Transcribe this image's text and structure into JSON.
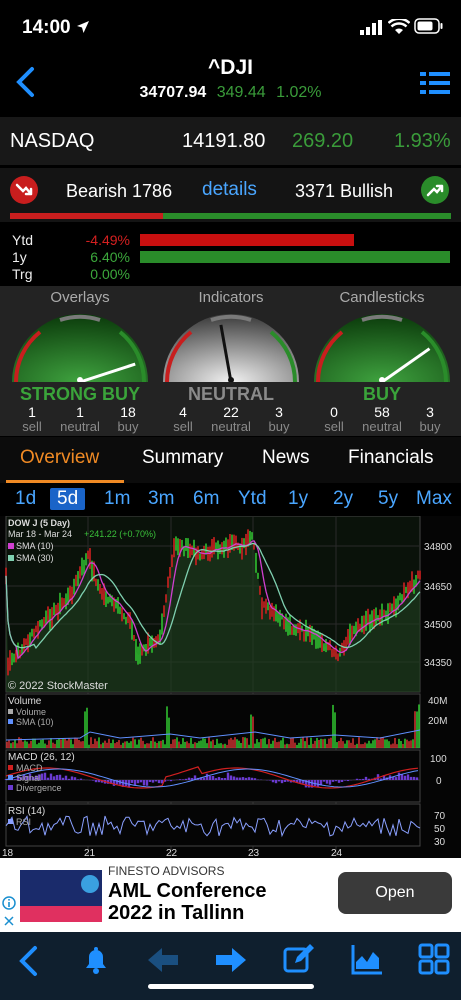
{
  "status": {
    "time": "14:00"
  },
  "header": {
    "ticker": "^DJI",
    "price": "34707.94",
    "change": "349.44",
    "change_pct": "1.02%"
  },
  "index_row": {
    "name": "NASDAQ",
    "value": "14191.80",
    "change": "269.20",
    "change_pct": "1.93%"
  },
  "sentiment": {
    "bearish": "Bearish 1786",
    "details": "details",
    "bullish": "3371 Bullish",
    "bearish_fraction": 0.346
  },
  "performance": [
    {
      "label": "Ytd",
      "value": "-4.49%",
      "color": "#d42020",
      "bar_fraction": 0.69,
      "bar_color": "#c80f0f"
    },
    {
      "label": "1y",
      "value": "6.40%",
      "color": "#3ca83c",
      "bar_fraction": 1.0,
      "bar_color": "#2a8c2a"
    },
    {
      "label": "Trg",
      "value": "0.00%",
      "color": "#3ca83c",
      "bar_fraction": 0,
      "bar_color": "#2a8c2a"
    }
  ],
  "gauges": [
    {
      "title": "Overlays",
      "signal": "STRONG BUY",
      "signal_color": "#3aa43a",
      "counts": [
        "1",
        "1",
        "18"
      ],
      "subs": [
        "sell",
        "neutral",
        "buy"
      ]
    },
    {
      "title": "Indicators",
      "signal": "NEUTRAL",
      "signal_color": "#8a8a8a",
      "counts": [
        "4",
        "22",
        "3"
      ],
      "subs": [
        "sell",
        "neutral",
        "buy"
      ]
    },
    {
      "title": "Candlesticks",
      "signal": "BUY",
      "signal_color": "#3aa43a",
      "counts": [
        "0",
        "58",
        "3"
      ],
      "subs": [
        "sell",
        "neutral",
        "buy"
      ]
    }
  ],
  "tabs": [
    "Overview",
    "Summary",
    "News",
    "Financials"
  ],
  "periods": [
    "1d",
    "5d",
    "1m",
    "3m",
    "6m",
    "Ytd",
    "1y",
    "2y",
    "5y",
    "Max"
  ],
  "chart": {
    "title": "DOW J (5 Day)",
    "range": "Mar 18 - Mar 24",
    "change": "+241.22 (+0.70%)",
    "legend_sma10": "SMA (10)",
    "legend_sma30": "SMA (30)",
    "copyright": "© 2022 StockMaster",
    "price_ticks": [
      "34800",
      "34650",
      "34500",
      "34350"
    ],
    "volume_title": "Volume",
    "volume_legend": [
      "Volume",
      "SMA (10)"
    ],
    "volume_ticks": [
      "40M",
      "20M"
    ],
    "macd_title": "MACD (26, 12)",
    "macd_legend": [
      "MACD",
      "Signal",
      "Divergence"
    ],
    "macd_ticks": [
      "100",
      "0"
    ],
    "rsi_title": "RSI (14)",
    "rsi_legend": [
      "RSI"
    ],
    "rsi_ticks": [
      "70",
      "50",
      "30"
    ],
    "x_labels": [
      "18",
      "21",
      "22",
      "23",
      "24"
    ]
  },
  "ad": {
    "source": "FINESTO ADVISORS",
    "title_line1": "AML Conference",
    "title_line2": "2022 in Tallinn",
    "button": "Open"
  },
  "bottom_icons": [
    "back-icon",
    "bell-icon",
    "arrow-left-icon",
    "arrow-right-icon",
    "edit-icon",
    "chart-icon",
    "grid-icon"
  ],
  "colors": {
    "accent": "#f08a24",
    "blue": "#4aa6ff",
    "green": "#3a9c3a",
    "red": "#c81e1e"
  }
}
